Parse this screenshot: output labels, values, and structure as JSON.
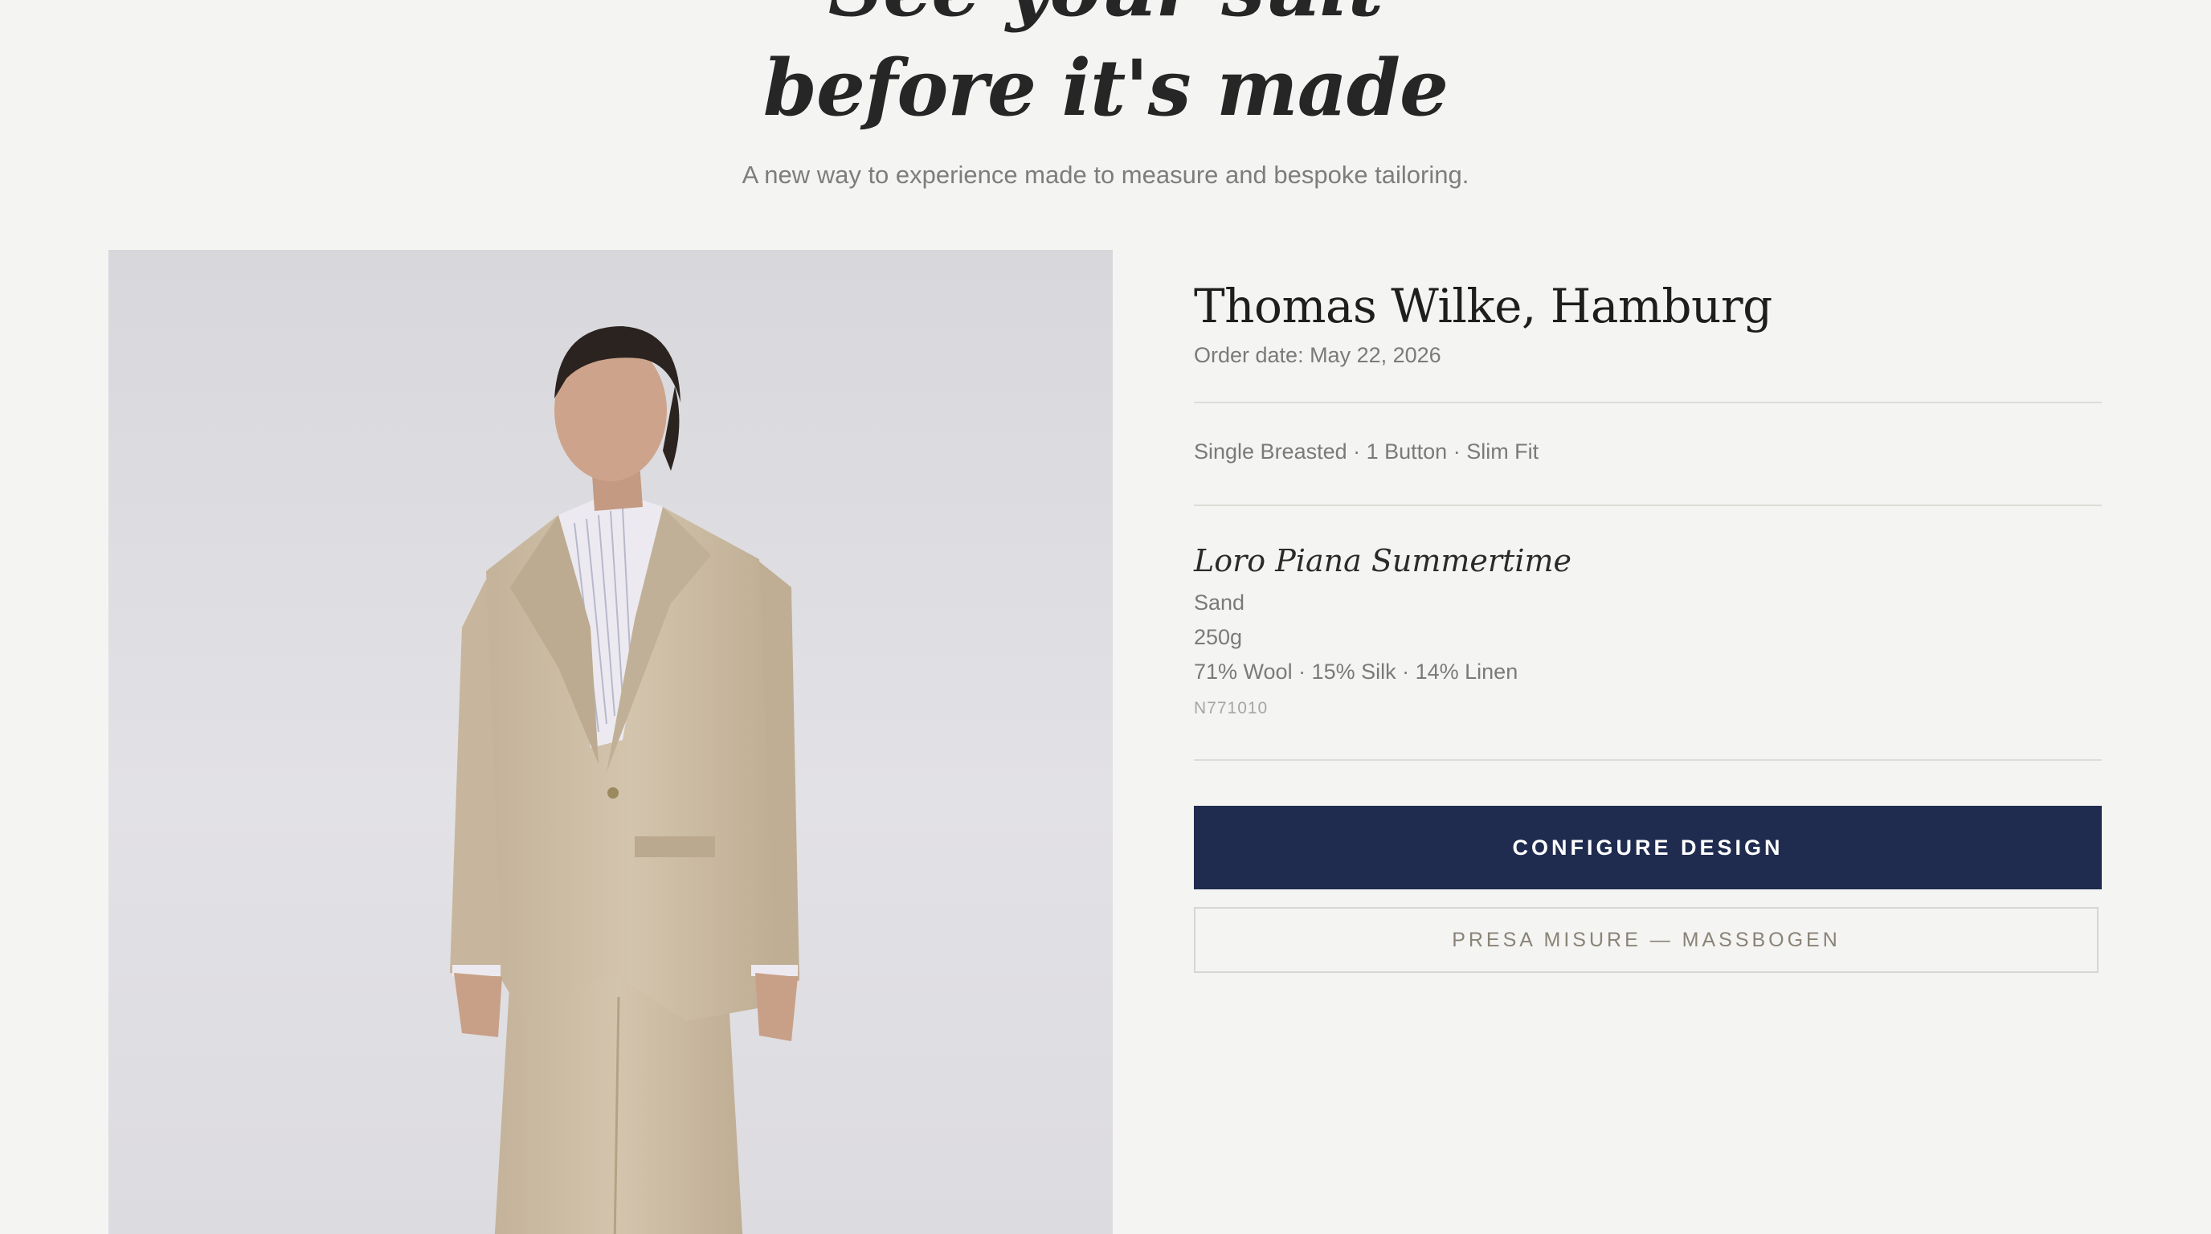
{
  "hero": {
    "title_line1": "See your suit",
    "title_line2": "before it's made",
    "subtitle": "A new way to experience made to measure and bespoke tailoring."
  },
  "order": {
    "customer": "Thomas Wilke, Hamburg",
    "order_date": "Order date: May 22, 2026",
    "style_summary": "Single Breasted · 1 Button · Slim Fit"
  },
  "fabric": {
    "name": "Loro Piana Summertime",
    "color": "Sand",
    "weight": "250g",
    "composition": "71% Wool · 15% Silk · 14% Linen",
    "code": "N771010"
  },
  "actions": {
    "primary_label": "CONFIGURE DESIGN",
    "secondary_label": "PRESA MISURE — MASSBOGEN"
  },
  "colors": {
    "background": "#f4f4f2",
    "accent_navy": "#1f2b4f",
    "suit_sand": "#cbbba4"
  }
}
